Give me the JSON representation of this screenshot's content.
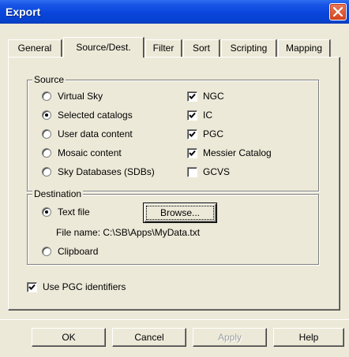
{
  "window": {
    "title": "Export",
    "close_icon": "close-icon"
  },
  "tabs": [
    {
      "label": "General",
      "active": false
    },
    {
      "label": "Source/Dest.",
      "active": true
    },
    {
      "label": "Filter",
      "active": false
    },
    {
      "label": "Sort",
      "active": false
    },
    {
      "label": "Scripting",
      "active": false
    },
    {
      "label": "Mapping",
      "active": false
    }
  ],
  "source": {
    "legend": "Source",
    "radios": [
      {
        "label": "Virtual Sky",
        "checked": false
      },
      {
        "label": "Selected catalogs",
        "checked": true
      },
      {
        "label": "User data content",
        "checked": false
      },
      {
        "label": "Mosaic content",
        "checked": false
      },
      {
        "label": "Sky Databases (SDBs)",
        "checked": false
      }
    ],
    "catalogs": [
      {
        "label": "NGC",
        "checked": true
      },
      {
        "label": "IC",
        "checked": true
      },
      {
        "label": "PGC",
        "checked": true
      },
      {
        "label": "Messier Catalog",
        "checked": true
      },
      {
        "label": "GCVS",
        "checked": false
      }
    ]
  },
  "destination": {
    "legend": "Destination",
    "text_file_label": "Text file",
    "text_file_checked": true,
    "browse_label": "Browse...",
    "file_name_label": "File name:",
    "file_name_value": "C:\\SB\\Apps\\MyData.txt",
    "clipboard_label": "Clipboard",
    "clipboard_checked": false
  },
  "use_pgc": {
    "label": "Use PGC identifiers",
    "checked": true
  },
  "buttons": {
    "ok": "OK",
    "cancel": "Cancel",
    "apply": "Apply",
    "help": "Help"
  }
}
